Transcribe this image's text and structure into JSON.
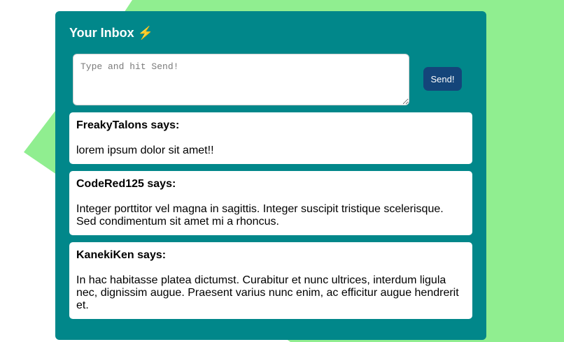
{
  "colors": {
    "background_shape": "#90ee90",
    "card": "#01878a",
    "send_button": "#14457a",
    "message_card": "#ffffff"
  },
  "header": {
    "title": "Your Inbox ⚡"
  },
  "compose": {
    "placeholder": "Type and hit Send!",
    "value": "",
    "send_label": "Send!"
  },
  "messages": [
    {
      "author": "FreakyTalons says:",
      "body": "lorem ipsum dolor sit amet!!"
    },
    {
      "author": "CodeRed125 says:",
      "body": "Integer porttitor vel magna in sagittis. Integer suscipit tristique scelerisque. Sed condimentum sit amet mi a rhoncus."
    },
    {
      "author": "KanekiKen says:",
      "body": "In hac habitasse platea dictumst. Curabitur et nunc ultrices, interdum ligula nec, dignissim augue. Praesent varius nunc enim, ac efficitur augue hendrerit et."
    }
  ]
}
